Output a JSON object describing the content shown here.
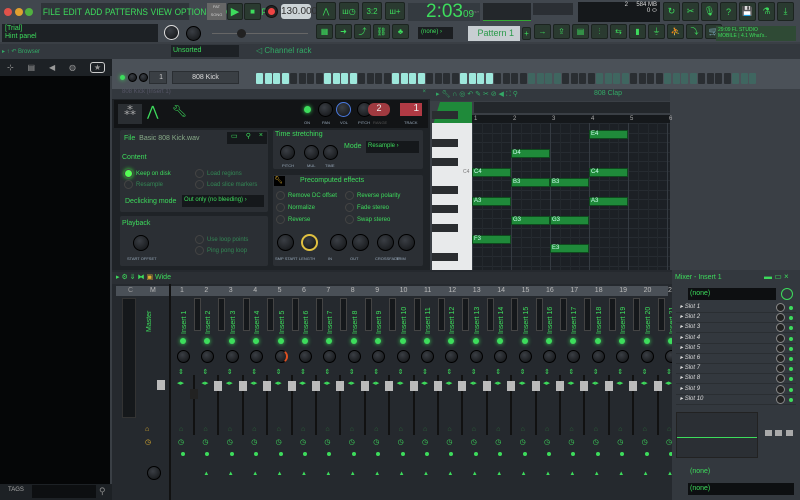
{
  "menu": [
    "FILE",
    "EDIT",
    "ADD",
    "PATTERNS",
    "VIEW",
    "OPTIONS",
    "TOOLS",
    "HELP"
  ],
  "transport": {
    "pat": "PAT",
    "song": "SONG",
    "tempo": "130.000",
    "time": "2:03",
    "time_sub": "09",
    "time_label": "B:S:T"
  },
  "hint": {
    "line1": "[Trial]",
    "line2": "Hint panel"
  },
  "cpu": {
    "mem": "584 MB",
    "voices": "2",
    "poly": "0"
  },
  "pattern": {
    "snap": "(none)",
    "name": "Pattern 1"
  },
  "news": {
    "time": "29:09",
    "text1": "FL STUDIO",
    "text2": "MOBILE | 4.1 What's.."
  },
  "browser": {
    "title": "Browser",
    "tags": "TAGS"
  },
  "channel_rack": {
    "filter": "Unsorted",
    "title": "Channel rack",
    "channel_num": "1",
    "channel_name": "808 Kick",
    "steps": [
      1,
      1,
      1,
      1,
      0,
      0,
      0,
      0,
      1,
      1,
      1,
      1,
      0,
      0,
      0,
      0,
      1,
      1,
      1,
      1,
      0,
      0,
      0,
      0,
      1,
      1,
      1,
      1,
      0,
      0,
      0,
      0,
      2,
      2,
      2,
      2,
      0,
      0,
      0,
      0,
      2,
      2,
      2,
      2,
      0,
      0,
      0,
      0,
      2,
      2,
      2,
      2,
      0,
      0,
      0,
      0,
      2,
      2,
      2
    ]
  },
  "sampler": {
    "title": "808 Kick (Insert 1)",
    "on": "ON",
    "pan": "PAN",
    "vol": "VOL",
    "pitch": "PITCH",
    "range": "RANGE",
    "range_val": "2",
    "track": "TRACK",
    "track_val": "1",
    "file_label": "File",
    "file_name": "Basic 808 Kick.wav",
    "content": "Content",
    "keep_on_disk": "Keep on disk",
    "resample": "Resample",
    "load_regions": "Load regions",
    "load_slice": "Load slice markers",
    "declick_label": "Declicking mode",
    "declick_value": "Out only (no bleeding)",
    "playback": "Playback",
    "start_offset": "START OFFSET",
    "use_loop": "Use loop points",
    "ping_pong": "Ping pong loop",
    "time_stretch": "Time stretching",
    "ts_pitch": "PITCH",
    "ts_mul": "MUL",
    "ts_time": "TIME",
    "mode_label": "Mode",
    "mode_value": "Resample",
    "precomputed": "Precomputed effects",
    "fx": [
      "Remove DC offset",
      "Reverse polarity",
      "Normalize",
      "Fade stereo",
      "Reverse",
      "Swap stereo"
    ],
    "knobs": [
      "SMP START",
      "LENGTH",
      "IN",
      "OUT",
      "CROSSFADE",
      "TRIM"
    ]
  },
  "piano_roll": {
    "channel": "808 Clap",
    "bars": [
      "1",
      "2",
      "3",
      "4",
      "5",
      "6"
    ],
    "key_label": "C4",
    "notes": [
      {
        "n": "E4",
        "p": 64,
        "s": 4,
        "l": 1
      },
      {
        "n": "D4",
        "p": 62,
        "s": 2,
        "l": 1
      },
      {
        "n": "C4",
        "p": 60,
        "s": 1,
        "l": 1
      },
      {
        "n": "C4",
        "p": 60,
        "s": 4,
        "l": 1
      },
      {
        "n": "B3",
        "p": 59,
        "s": 2,
        "l": 1
      },
      {
        "n": "B3",
        "p": 59,
        "s": 3,
        "l": 1
      },
      {
        "n": "A3",
        "p": 57,
        "s": 1,
        "l": 1
      },
      {
        "n": "A3",
        "p": 57,
        "s": 4,
        "l": 1
      },
      {
        "n": "G3",
        "p": 55,
        "s": 2,
        "l": 1
      },
      {
        "n": "G3",
        "p": 55,
        "s": 3,
        "l": 1
      },
      {
        "n": "F3",
        "p": 53,
        "s": 1,
        "l": 1
      },
      {
        "n": "E3",
        "p": 52,
        "s": 3,
        "l": 1
      }
    ]
  },
  "mixer": {
    "preset": "Wide",
    "header_c": "C",
    "header_m": "M",
    "master": "Master",
    "inserts": [
      "Insert 1",
      "Insert 2",
      "Insert 3",
      "Insert 4",
      "Insert 5",
      "Insert 6",
      "Insert 7",
      "Insert 8",
      "Insert 9",
      "Insert 10",
      "Insert 11",
      "Insert 12",
      "Insert 13",
      "Insert 14",
      "Insert 15",
      "Insert 16",
      "Insert 17",
      "Insert 18",
      "Insert 19",
      "Insert 20",
      "Insert 21"
    ]
  },
  "insert_panel": {
    "title": "Mixer - Insert 1",
    "input": "(none)",
    "slots": [
      "Slot 1",
      "Slot 2",
      "Slot 3",
      "Slot 4",
      "Slot 5",
      "Slot 6",
      "Slot 7",
      "Slot 8",
      "Slot 9",
      "Slot 10"
    ],
    "send": "(none)",
    "output": "(none)"
  }
}
